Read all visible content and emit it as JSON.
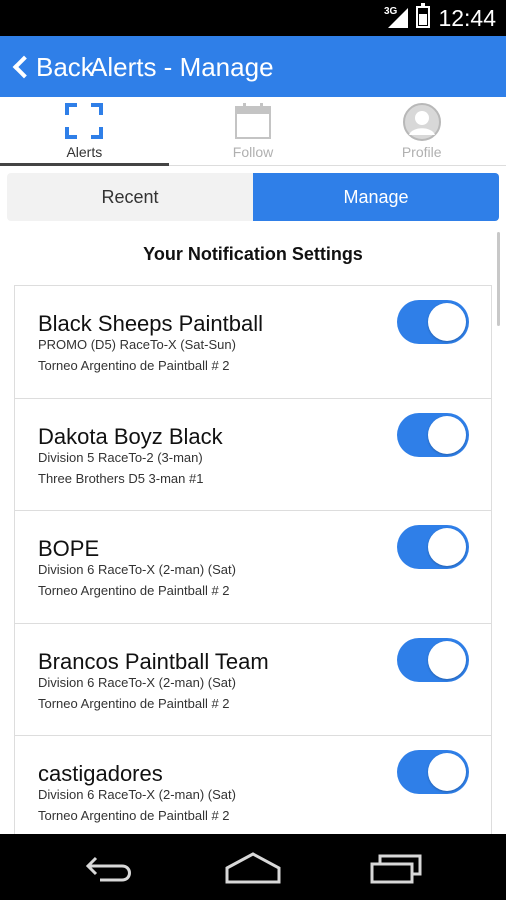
{
  "status_bar": {
    "network": "3G",
    "time": "12:44"
  },
  "app_bar": {
    "back_label": "Back",
    "title": "Alerts - Manage"
  },
  "top_tabs": [
    {
      "label": "Alerts",
      "icon": "scan-frame-icon",
      "active": true
    },
    {
      "label": "Follow",
      "icon": "calendar-icon",
      "active": false
    },
    {
      "label": "Profile",
      "icon": "person-icon",
      "active": false
    }
  ],
  "segments": {
    "recent": "Recent",
    "manage": "Manage",
    "selected": "Manage"
  },
  "section_title": "Your Notification Settings",
  "notifications": [
    {
      "team": "Black Sheeps Paintball",
      "division": "PROMO (D5) RaceTo-X (Sat-Sun)",
      "event": "Torneo Argentino de Paintball # 2",
      "enabled": true
    },
    {
      "team": "Dakota Boyz Black",
      "division": "Division 5 RaceTo-2 (3-man)",
      "event": "Three Brothers D5 3-man #1",
      "enabled": true
    },
    {
      "team": "BOPE",
      "division": "Division 6 RaceTo-X (2-man) (Sat)",
      "event": "Torneo Argentino de Paintball # 2",
      "enabled": true
    },
    {
      "team": "Brancos Paintball Team",
      "division": "Division 6 RaceTo-X (2-man) (Sat)",
      "event": "Torneo Argentino de Paintball # 2",
      "enabled": true
    },
    {
      "team": "castigadores",
      "division": "Division 6 RaceTo-X (2-man) (Sat)",
      "event": "Torneo Argentino de Paintball # 2",
      "enabled": true
    }
  ],
  "nav_bar": {
    "back": "back-arrow-icon",
    "home": "home-icon",
    "recents": "recent-apps-icon"
  },
  "colors": {
    "accent": "#2f7fe8",
    "status_bar": "#000000",
    "nav_bar": "#000000"
  }
}
